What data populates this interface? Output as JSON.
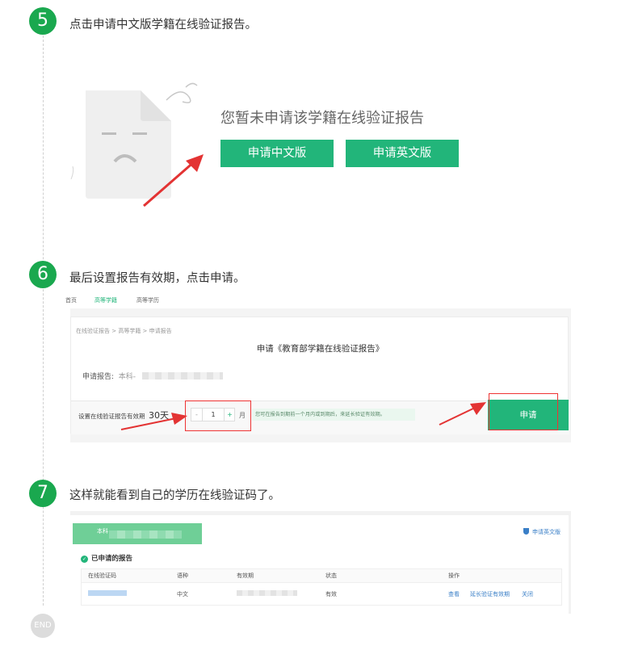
{
  "steps": [
    {
      "number": "5",
      "text": "点击申请中文版学籍在线验证报告。"
    },
    {
      "number": "6",
      "text": "最后设置报告有效期，点击申请。"
    },
    {
      "number": "7",
      "text": "这样就能看到自己的学历在线验证码了。"
    }
  ],
  "end_label": "END",
  "step5": {
    "empty_message": "您暂未申请该学籍在线验证报告",
    "apply_cn_label": "申请中文版",
    "apply_en_label": "申请英文版"
  },
  "step6": {
    "tabs": [
      "首页",
      "高等学籍",
      "高等学历"
    ],
    "breadcrumb": "在线验证报告 > 高等学籍 > 申请报告",
    "title": "申请《教育部学籍在线验证报告》",
    "report_label": "申请报告:",
    "report_value": "本科-",
    "validity_label": "设置在线验证报告有效期",
    "validity_days": "30天",
    "stepper": {
      "minus": "-",
      "value": "1",
      "plus": "+"
    },
    "month_unit": "月",
    "hint": "您可在报告到期前一个月内或到期后，来延长验证有效期。",
    "apply_label": "申请"
  },
  "step7": {
    "banner_text": "本科",
    "apply_en_link": "申请英文版",
    "section_title": "已申请的报告",
    "columns": [
      "在线验证码",
      "语种",
      "有效期",
      "状态",
      "操作"
    ],
    "row": {
      "language": "中文",
      "status": "有效",
      "actions": [
        "查看",
        "延长验证有效期",
        "关闭"
      ]
    }
  },
  "colors": {
    "accent_green": "#22b57a",
    "badge_green": "#1aa84f",
    "arrow_red": "#e33333"
  }
}
